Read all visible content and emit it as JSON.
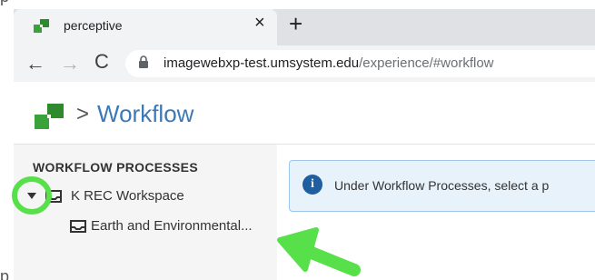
{
  "browser": {
    "tab_title": "perceptive",
    "tab_close": "×",
    "new_tab": "+",
    "nav_back": "←",
    "nav_forward": "→",
    "nav_reload": "C",
    "url_host": "imagewebxp-test.umsystem.edu",
    "url_path": "/experience/#workflow"
  },
  "app": {
    "breadcrumb_separator": ">",
    "page_title": "Workflow",
    "brand_color": "#3aa23a",
    "title_color": "#3c79b7"
  },
  "sidebar": {
    "section_heading": "WORKFLOW PROCESSES",
    "tree": [
      {
        "label": "K REC Workspace",
        "expanded": true
      },
      {
        "label": "Earth and Environmental..."
      }
    ]
  },
  "info_banner": {
    "icon": "info-icon",
    "icon_glyph": "i",
    "text": "Under Workflow Processes, select a p"
  },
  "annotations": {
    "highlight_color": "#57e04a",
    "items": [
      "circle around expand toggle",
      "arrow pointing to Earth and Environmental..."
    ]
  }
}
